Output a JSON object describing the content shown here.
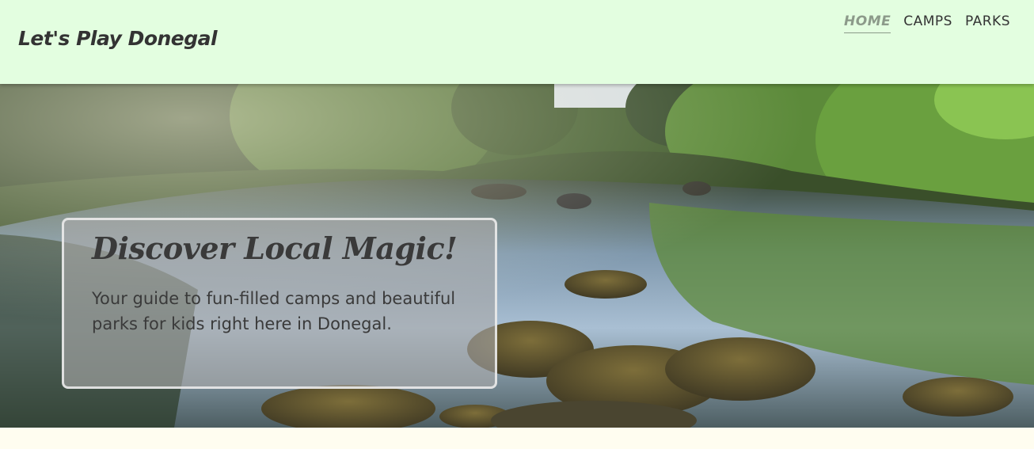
{
  "header": {
    "logo": "Let's Play Donegal",
    "nav": [
      {
        "label": "HOME",
        "active": true
      },
      {
        "label": "CAMPS",
        "active": false
      },
      {
        "label": "PARKS",
        "active": false
      }
    ]
  },
  "hero": {
    "title": "Discover Local Magic!",
    "subtitle": "Your guide to fun-filled camps and beautiful parks for kids right here in Donegal."
  },
  "colors": {
    "header_bg": "#e3fee0",
    "page_bg": "#fffdf0",
    "text": "#333333",
    "active_nav": "#8c9a8a"
  }
}
